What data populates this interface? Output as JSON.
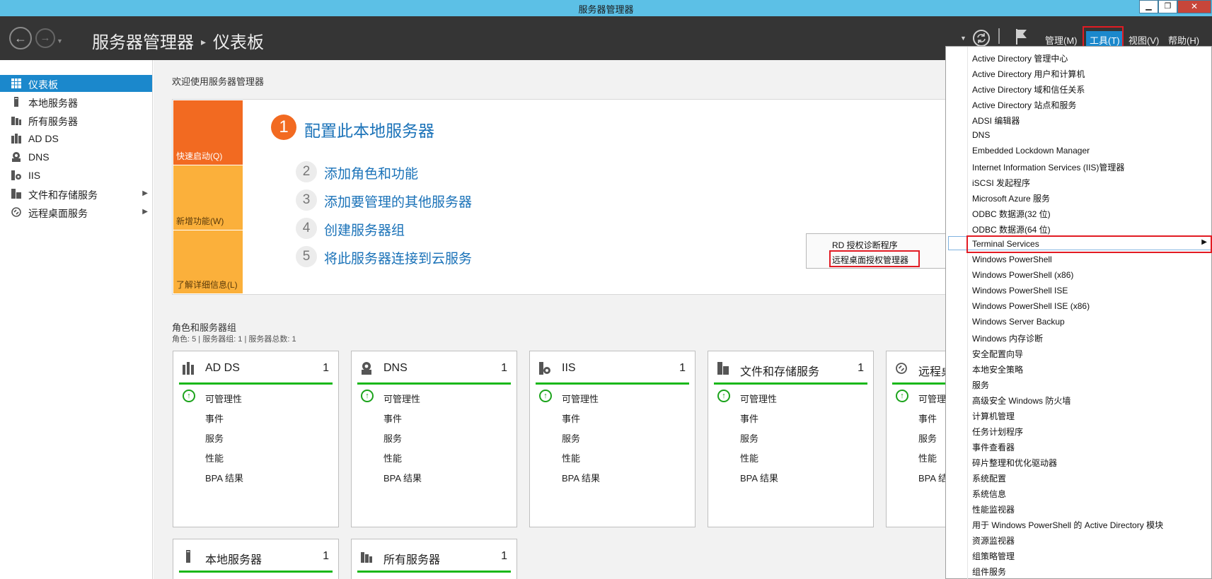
{
  "window": {
    "title": "服务器管理器",
    "min_label": "▁",
    "restore_label": "❐",
    "close_label": "✕"
  },
  "header": {
    "breadcrumb_app": "服务器管理器",
    "breadcrumb_sep": "▸",
    "breadcrumb_page": "仪表板",
    "menus": {
      "manage": "管理(M)",
      "tools": "工具(T)",
      "view": "视图(V)",
      "help": "帮助(H)"
    }
  },
  "sidebar": {
    "items": [
      {
        "label": "仪表板",
        "icon": "dashboard-icon",
        "selected": true
      },
      {
        "label": "本地服务器",
        "icon": "server-icon"
      },
      {
        "label": "所有服务器",
        "icon": "servers-icon"
      },
      {
        "label": "AD DS",
        "icon": "adds-icon"
      },
      {
        "label": "DNS",
        "icon": "dns-icon"
      },
      {
        "label": "IIS",
        "icon": "iis-icon"
      },
      {
        "label": "文件和存储服务",
        "icon": "storage-icon",
        "has_children": true
      },
      {
        "label": "远程桌面服务",
        "icon": "remote-desktop-icon",
        "has_children": true
      }
    ]
  },
  "welcome": {
    "title": "欢迎使用服务器管理器",
    "tiles": {
      "quick_start": "快速启动(Q)",
      "whats_new": "新增功能(W)",
      "learn_more": "了解详细信息(L)"
    },
    "steps": [
      {
        "num": "1",
        "text": "配置此本地服务器"
      },
      {
        "num": "2",
        "text": "添加角色和功能"
      },
      {
        "num": "3",
        "text": "添加要管理的其他服务器"
      },
      {
        "num": "4",
        "text": "创建服务器组"
      },
      {
        "num": "5",
        "text": "将此服务器连接到云服务"
      }
    ]
  },
  "terminal_submenu": {
    "items": [
      "RD 授权诊断程序",
      "远程桌面授权管理器"
    ]
  },
  "roles": {
    "title": "角色和服务器组",
    "summary": "角色: 5 | 服务器组: 1 | 服务器总数: 1",
    "row_labels": {
      "manageability": "可管理性",
      "events": "事件",
      "services": "服务",
      "performance": "性能",
      "bpa": "BPA 结果"
    },
    "cards": [
      {
        "name": "AD DS",
        "count": "1"
      },
      {
        "name": "DNS",
        "count": "1"
      },
      {
        "name": "IIS",
        "count": "1"
      },
      {
        "name": "文件和存储服务",
        "count": "1"
      },
      {
        "name": "远程桌",
        "count": ""
      },
      {
        "name": "本地服务器",
        "count": "1"
      },
      {
        "name": "所有服务器",
        "count": "1"
      }
    ],
    "card5_rows": [
      "可管理",
      "事件",
      "服务",
      "性能",
      "BPA 结"
    ]
  },
  "tools_menu": {
    "items": [
      "Active Directory 管理中心",
      "Active Directory 用户和计算机",
      "Active Directory 域和信任关系",
      "Active Directory 站点和服务",
      "ADSI 编辑器",
      "DNS",
      "Embedded Lockdown Manager",
      "Internet Information Services (IIS)管理器",
      "iSCSI 发起程序",
      "Microsoft Azure 服务",
      "ODBC 数据源(32 位)",
      "ODBC 数据源(64 位)",
      "Terminal Services",
      "Windows PowerShell",
      "Windows PowerShell (x86)",
      "Windows PowerShell ISE",
      "Windows PowerShell ISE (x86)",
      "Windows Server Backup",
      "Windows 内存诊断",
      "安全配置向导",
      "本地安全策略",
      "服务",
      "高级安全 Windows 防火墙",
      "计算机管理",
      "任务计划程序",
      "事件查看器",
      "碎片整理和优化驱动器",
      "系统配置",
      "系统信息",
      "性能监视器",
      "用于 Windows PowerShell 的 Active Directory 模块",
      "资源监视器",
      "组策略管理",
      "组件服务"
    ],
    "highlighted_index": 12
  },
  "colors": {
    "accent": "#1b88cc",
    "titlebar": "#5cc0e6",
    "header": "#353535",
    "orange": "#f26a21",
    "amber": "#fbb03b",
    "ok_green": "#1ab81a",
    "annotation_red": "#e21b23"
  }
}
